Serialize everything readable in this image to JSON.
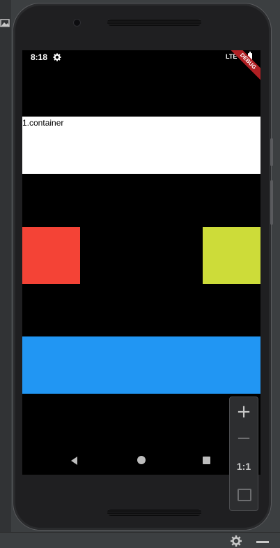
{
  "status_bar": {
    "time": "8:18",
    "network": "LTE"
  },
  "debug_banner": {
    "label": "DEBUG"
  },
  "containers": {
    "first_label": "1.container"
  },
  "colors": {
    "white_container": "#ffffff",
    "red_box": "#f44336",
    "lime_box": "#cddc39",
    "blue_container": "#2196f3",
    "screen_background": "#000000"
  },
  "zoom_controls": {
    "plus": "+",
    "minus": "−",
    "actual_size": "1:1"
  },
  "icons": {
    "status_settings": "gear-icon",
    "nav_back": "back-triangle-icon",
    "nav_home": "home-circle-icon",
    "nav_recent": "recent-square-icon",
    "zoom_fit": "fit-screen-icon",
    "ide_image": "image-icon",
    "ide_settings": "gear-icon"
  }
}
